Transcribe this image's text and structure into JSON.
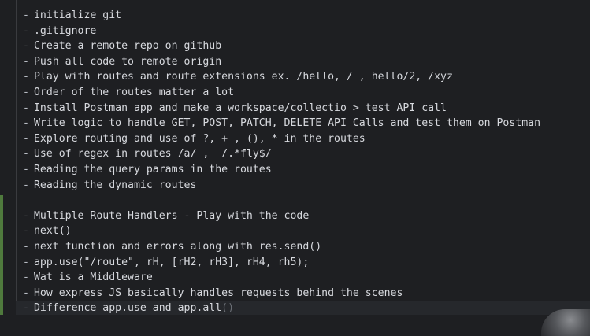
{
  "editor": {
    "bullet": "-",
    "group1": [
      "initialize git",
      ".gitignore",
      "Create a remote repo on github",
      "Push all code to remote origin",
      "Play with routes and route extensions ex. /hello, / , hello/2, /xyz",
      "Order of the routes matter a lot",
      "Install Postman app and make a workspace/collectio > test API call",
      "Write logic to handle GET, POST, PATCH, DELETE API Calls and test them on Postman",
      "Explore routing and use of ?, + , (), * in the routes",
      "Use of regex in routes /a/ ,  /.*fly$/",
      "Reading the query params in the routes",
      "Reading the dynamic routes"
    ],
    "group2": [
      "Multiple Route Handlers - Play with the code",
      "next()",
      "next function and errors along with res.send()",
      "app.use(\"/route\", rH, [rH2, rH3], rH4, rh5);",
      "Wat is a Middleware",
      "How express JS basically handles requests behind the scenes"
    ],
    "last_line": {
      "text": "Difference app.use and app.all",
      "hint": "()"
    }
  },
  "colors": {
    "background": "#1e1f22",
    "text": "#d7d9de",
    "change_marker": "#4f7a3d"
  }
}
